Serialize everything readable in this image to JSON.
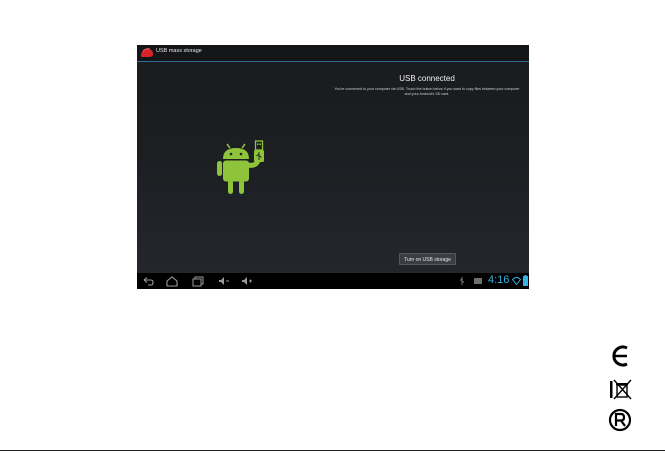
{
  "titlebar": {
    "title": "USB mass storage"
  },
  "main": {
    "heading": "USB connected",
    "description": "You're connected to your computer via USB. Touch the button below if you want to copy files between your computer and your Android's SD card.",
    "usb_button_label": "Turn on USB storage"
  },
  "statusbar": {
    "time": "4:16",
    "icons": [
      "usb-icon",
      "notification-icon",
      "wifi-icon",
      "battery-icon"
    ]
  },
  "navbar": {
    "icons": [
      "back-icon",
      "home-icon",
      "recent-apps-icon",
      "volume-down-icon",
      "volume-up-icon"
    ]
  },
  "colors": {
    "accent": "#33b5e5",
    "android_green": "#8fc43a",
    "app_icon_red": "#d8232a"
  },
  "marks": [
    "ce-mark-icon",
    "weee-bin-icon",
    "recycle-mark-icon"
  ]
}
